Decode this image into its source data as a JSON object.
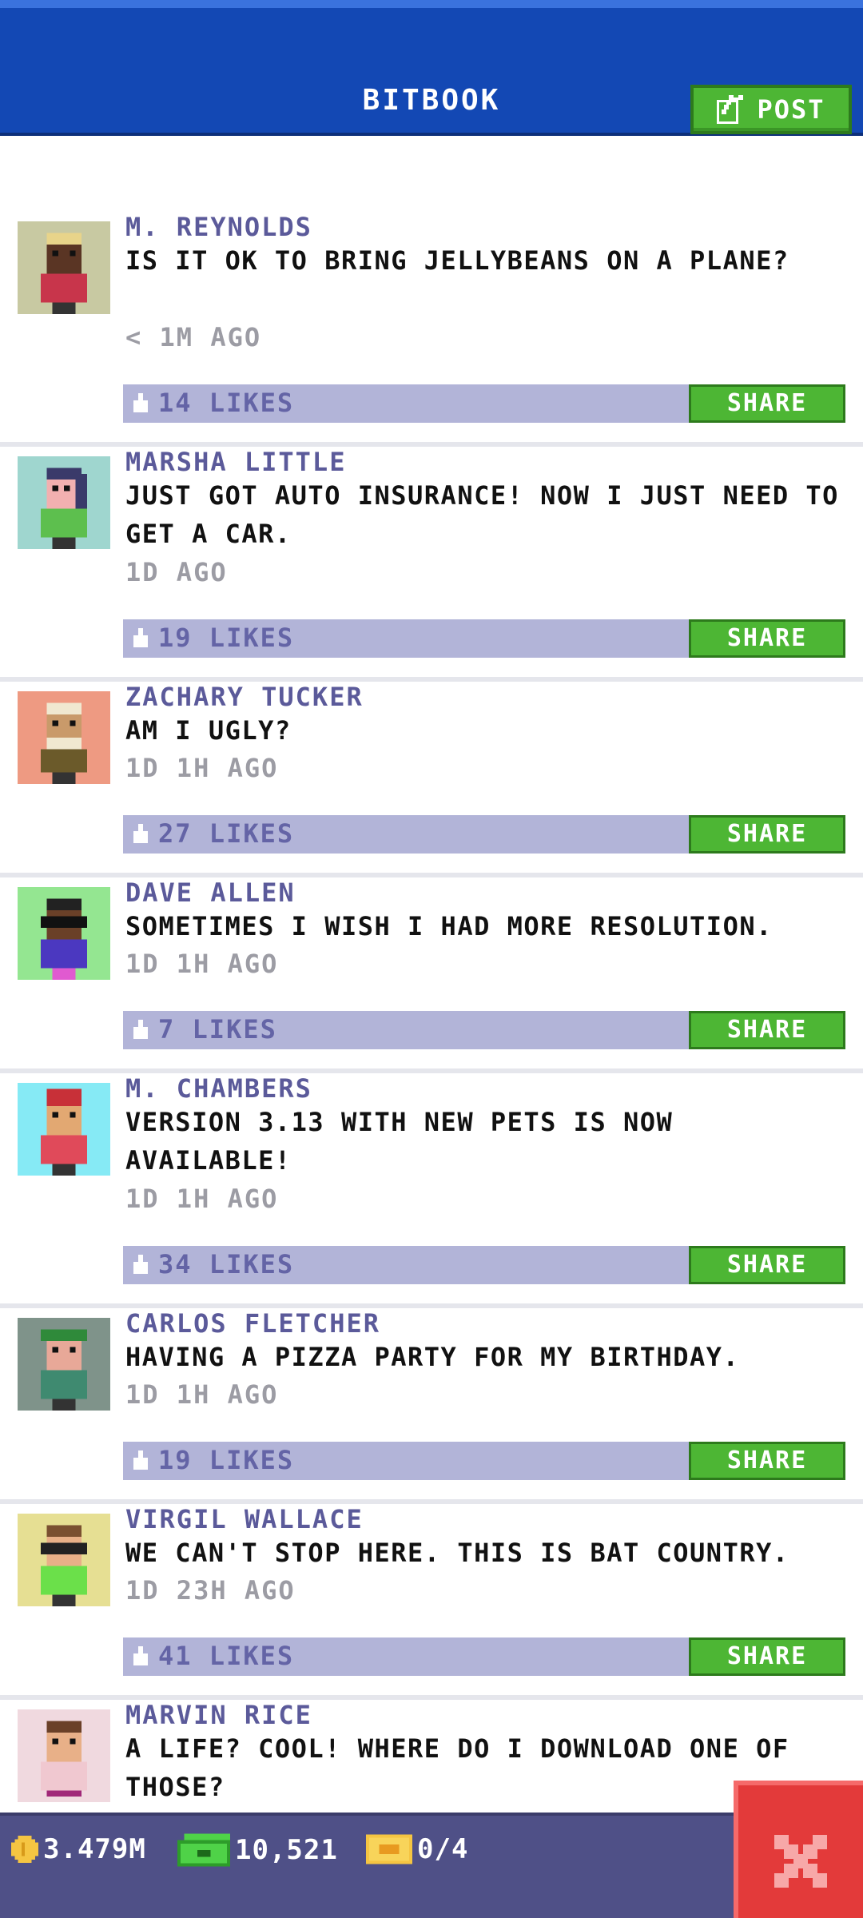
{
  "header": {
    "title": "BITBOOK",
    "post_label": "POST"
  },
  "posts": [
    {
      "name": "M. REYNOLDS",
      "text": "IS IT OK TO BRING JELLYBEANS ON A PLANE?",
      "time": "< 1M AGO",
      "likes": "14 LIKES",
      "share": "SHARE",
      "avatar_bg": "#c8c9a2"
    },
    {
      "name": "MARSHA LITTLE",
      "text": "JUST GOT AUTO INSURANCE! NOW I JUST NEED TO GET A CAR.",
      "time": "1D AGO",
      "likes": "19 LIKES",
      "share": "SHARE",
      "avatar_bg": "#9fd6cf"
    },
    {
      "name": "ZACHARY TUCKER",
      "text": "AM I UGLY?",
      "time": "1D 1H AGO",
      "likes": "27 LIKES",
      "share": "SHARE",
      "avatar_bg": "#ee9a82"
    },
    {
      "name": "DAVE ALLEN",
      "text": "SOMETIMES I WISH I HAD MORE RESOLUTION.",
      "time": "1D 1H AGO",
      "likes": "7 LIKES",
      "share": "SHARE",
      "avatar_bg": "#94e691"
    },
    {
      "name": "M. CHAMBERS",
      "text": "VERSION 3.13 WITH NEW PETS IS NOW AVAILABLE!",
      "time": "1D 1H AGO",
      "likes": "34 LIKES",
      "share": "SHARE",
      "avatar_bg": "#86eaf5"
    },
    {
      "name": "CARLOS FLETCHER",
      "text": "HAVING A PIZZA PARTY FOR MY BIRTHDAY.",
      "time": "1D 1H AGO",
      "likes": "19 LIKES",
      "share": "SHARE",
      "avatar_bg": "#7f938a"
    },
    {
      "name": "VIRGIL WALLACE",
      "text": "WE CAN'T STOP HERE. THIS IS BAT COUNTRY.",
      "time": "1D 23H AGO",
      "likes": "41 LIKES",
      "share": "SHARE",
      "avatar_bg": "#e6df93"
    },
    {
      "name": "MARVIN RICE",
      "text": "A LIFE? COOL! WHERE DO I DOWNLOAD ONE OF THOSE?",
      "time": "",
      "likes": "",
      "share": "",
      "avatar_bg": "#f0d9df"
    }
  ],
  "footer": {
    "coins": "3.479M",
    "bux": "10,521",
    "tickets": "0/4"
  },
  "colors": {
    "header": "#1348b4",
    "accent_green": "#4db634",
    "like_bar": "#b2b4d8",
    "name_text": "#5b5a9a",
    "close_red": "#e33a3a"
  }
}
